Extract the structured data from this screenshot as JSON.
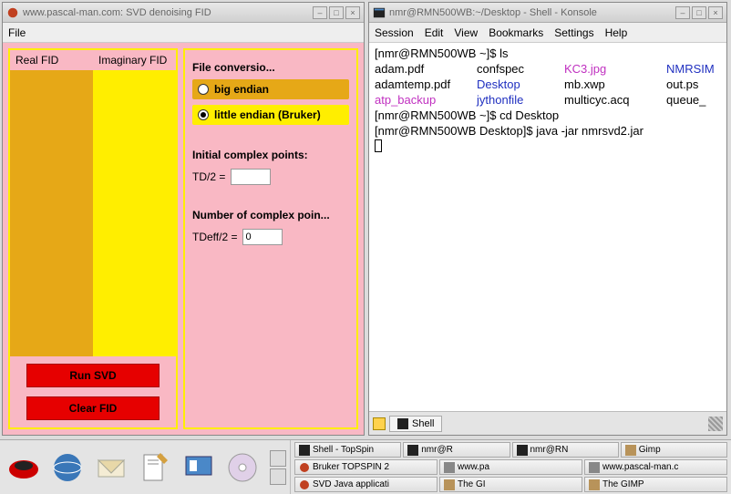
{
  "left_app": {
    "title": "www.pascal-man.com: SVD denoising FID",
    "menu_file": "File",
    "real_label": "Real FID",
    "imag_label": "Imaginary FID",
    "file_conv_title": "File conversio...",
    "radio_big": "big endian",
    "radio_little": "little endian (Bruker)",
    "init_pts_title": "Initial complex points:",
    "td_label": "TD/2 =",
    "td_value": "",
    "num_pts_title": "Number of complex poin...",
    "tdeff_label": "TDeff/2 =",
    "tdeff_value": "0",
    "run_btn": "Run SVD",
    "clear_btn": "Clear FID"
  },
  "right_app": {
    "title": "nmr@RMN500WB:~/Desktop - Shell - Konsole",
    "menu": {
      "session": "Session",
      "edit": "Edit",
      "view": "View",
      "bookmarks": "Bookmarks",
      "settings": "Settings",
      "help": "Help"
    },
    "shell_tab": "Shell",
    "term": {
      "l1_prompt": "[nmr@RMN500WB ~]$ ",
      "l1_cmd": "ls",
      "row1": {
        "a": "adam.pdf",
        "b": "confspec",
        "c": "KC3.jpg",
        "d": "NMRSIM"
      },
      "row2": {
        "a": "adamtemp.pdf",
        "b": "Desktop",
        "c": "mb.xwp",
        "d": "out.ps"
      },
      "row3": {
        "a": "atp_backup",
        "b": "jythonfile",
        "c": "multicyc.acq",
        "d": "queue_"
      },
      "l5_prompt": "[nmr@RMN500WB ~]$ ",
      "l5_cmd": "cd Desktop",
      "l6_prompt": "[nmr@RMN500WB Desktop]$ ",
      "l6_cmd": "java -jar nmrsvd2.jar"
    }
  },
  "taskbar": {
    "items": [
      "Shell - TopSpin",
      "nmr@R",
      "nmr@RN",
      "Gimp",
      "Bruker TOPSPIN 2",
      "www.pa",
      "www.pascal-man.c",
      "SVD Java applicati",
      "The GI",
      "The GIMP"
    ]
  }
}
